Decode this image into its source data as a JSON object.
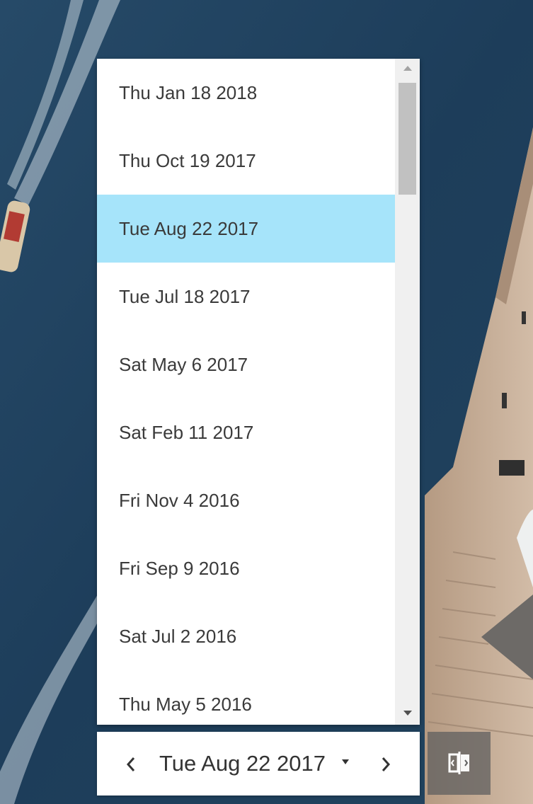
{
  "date_list": {
    "items": [
      {
        "label": "Thu Jan 18 2018"
      },
      {
        "label": "Thu Oct 19 2017"
      },
      {
        "label": "Tue Aug 22 2017"
      },
      {
        "label": "Tue Jul 18 2017"
      },
      {
        "label": "Sat May 6 2017"
      },
      {
        "label": "Sat Feb 11 2017"
      },
      {
        "label": "Fri Nov 4 2016"
      },
      {
        "label": "Fri Sep 9 2016"
      },
      {
        "label": "Sat Jul 2 2016"
      },
      {
        "label": "Thu May 5 2016"
      }
    ],
    "selected_label": "Tue Aug 22 2017"
  },
  "date_selector": {
    "current_date": "Tue Aug 22 2017",
    "prev_icon": "chevron-left-icon",
    "next_icon": "chevron-right-icon",
    "dropdown_icon": "caret-down-icon"
  },
  "compare_button": {
    "icon": "swipe-compare-icon"
  },
  "colors": {
    "selected_item_background": "#a6e4fa",
    "text": "#3a3a3a",
    "water": "#1e3f5c"
  }
}
